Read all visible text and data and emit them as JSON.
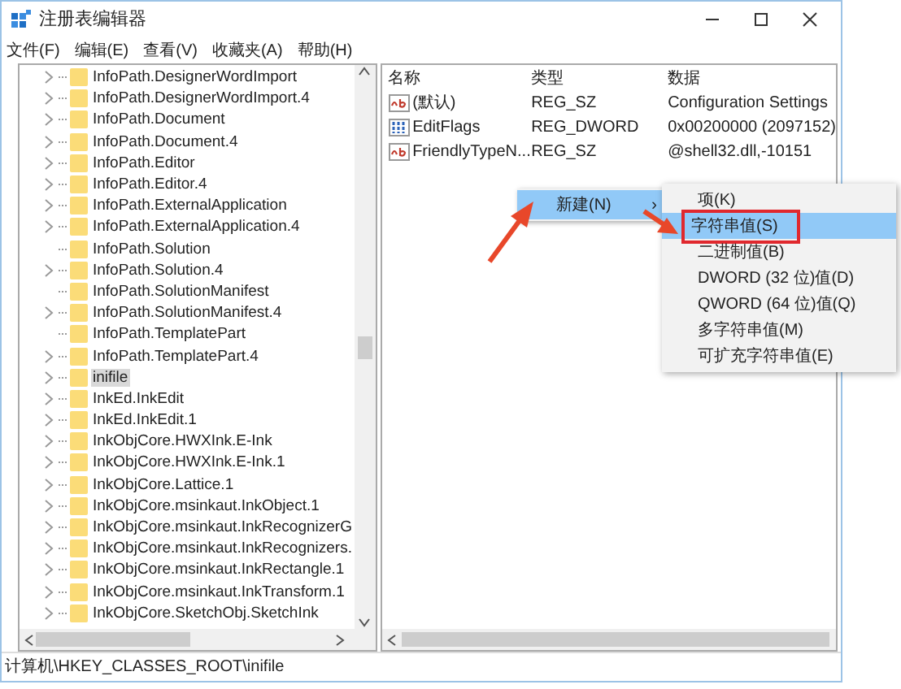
{
  "window": {
    "title": "注册表编辑器"
  },
  "menu": [
    "文件(F)",
    "编辑(E)",
    "查看(V)",
    "收藏夹(A)",
    "帮助(H)"
  ],
  "tree": {
    "items": [
      {
        "label": "InfoPath.DesignerWordImport",
        "expandable": true,
        "selected": false
      },
      {
        "label": "InfoPath.DesignerWordImport.4",
        "expandable": true,
        "selected": false
      },
      {
        "label": "InfoPath.Document",
        "expandable": true,
        "selected": false
      },
      {
        "label": "InfoPath.Document.4",
        "expandable": true,
        "selected": false
      },
      {
        "label": "InfoPath.Editor",
        "expandable": true,
        "selected": false
      },
      {
        "label": "InfoPath.Editor.4",
        "expandable": true,
        "selected": false
      },
      {
        "label": "InfoPath.ExternalApplication",
        "expandable": true,
        "selected": false
      },
      {
        "label": "InfoPath.ExternalApplication.4",
        "expandable": true,
        "selected": false
      },
      {
        "label": "InfoPath.Solution",
        "expandable": false,
        "selected": false
      },
      {
        "label": "InfoPath.Solution.4",
        "expandable": true,
        "selected": false
      },
      {
        "label": "InfoPath.SolutionManifest",
        "expandable": false,
        "selected": false
      },
      {
        "label": "InfoPath.SolutionManifest.4",
        "expandable": true,
        "selected": false
      },
      {
        "label": "InfoPath.TemplatePart",
        "expandable": false,
        "selected": false
      },
      {
        "label": "InfoPath.TemplatePart.4",
        "expandable": true,
        "selected": false
      },
      {
        "label": "inifile",
        "expandable": true,
        "selected": true
      },
      {
        "label": "InkEd.InkEdit",
        "expandable": true,
        "selected": false
      },
      {
        "label": "InkEd.InkEdit.1",
        "expandable": true,
        "selected": false
      },
      {
        "label": "InkObjCore.HWXInk.E-Ink",
        "expandable": true,
        "selected": false
      },
      {
        "label": "InkObjCore.HWXInk.E-Ink.1",
        "expandable": true,
        "selected": false
      },
      {
        "label": "InkObjCore.Lattice.1",
        "expandable": true,
        "selected": false
      },
      {
        "label": "InkObjCore.msinkaut.InkObject.1",
        "expandable": true,
        "selected": false
      },
      {
        "label": "InkObjCore.msinkaut.InkRecognizerG",
        "expandable": true,
        "selected": false
      },
      {
        "label": "InkObjCore.msinkaut.InkRecognizers.",
        "expandable": true,
        "selected": false
      },
      {
        "label": "InkObjCore.msinkaut.InkRectangle.1",
        "expandable": true,
        "selected": false
      },
      {
        "label": "InkObjCore.msinkaut.InkTransform.1",
        "expandable": true,
        "selected": false
      },
      {
        "label": "InkObjCore.SketchObj.SketchInk",
        "expandable": true,
        "selected": false
      }
    ]
  },
  "values": {
    "columns": [
      "名称",
      "类型",
      "数据"
    ],
    "rows": [
      {
        "kind": "string",
        "name": "(默认)",
        "type": "REG_SZ",
        "data": "Configuration Settings"
      },
      {
        "kind": "binary",
        "name": "EditFlags",
        "type": "REG_DWORD",
        "data": "0x00200000 (2097152)"
      },
      {
        "kind": "string",
        "name": "FriendlyTypeN...",
        "type": "REG_SZ",
        "data": "@shell32.dll,-10151"
      }
    ]
  },
  "context_menu": {
    "items": [
      {
        "label": "新建(N)",
        "arrow": "›",
        "selected": true
      }
    ]
  },
  "submenu": {
    "items": [
      {
        "label": "项(K)",
        "selected": false,
        "outlined": false
      },
      {
        "label": "字符串值(S)",
        "selected": true,
        "outlined": true
      },
      {
        "label": "二进制值(B)",
        "selected": false,
        "outlined": false
      },
      {
        "label": "DWORD (32 位)值(D)",
        "selected": false,
        "outlined": false
      },
      {
        "label": "QWORD (64 位)值(Q)",
        "selected": false,
        "outlined": false
      },
      {
        "label": "多字符串值(M)",
        "selected": false,
        "outlined": false
      },
      {
        "label": "可扩充字符串值(E)",
        "selected": false,
        "outlined": false
      }
    ]
  },
  "status_bar": {
    "path": "计算机\\HKEY_CLASSES_ROOT\\inifile"
  }
}
